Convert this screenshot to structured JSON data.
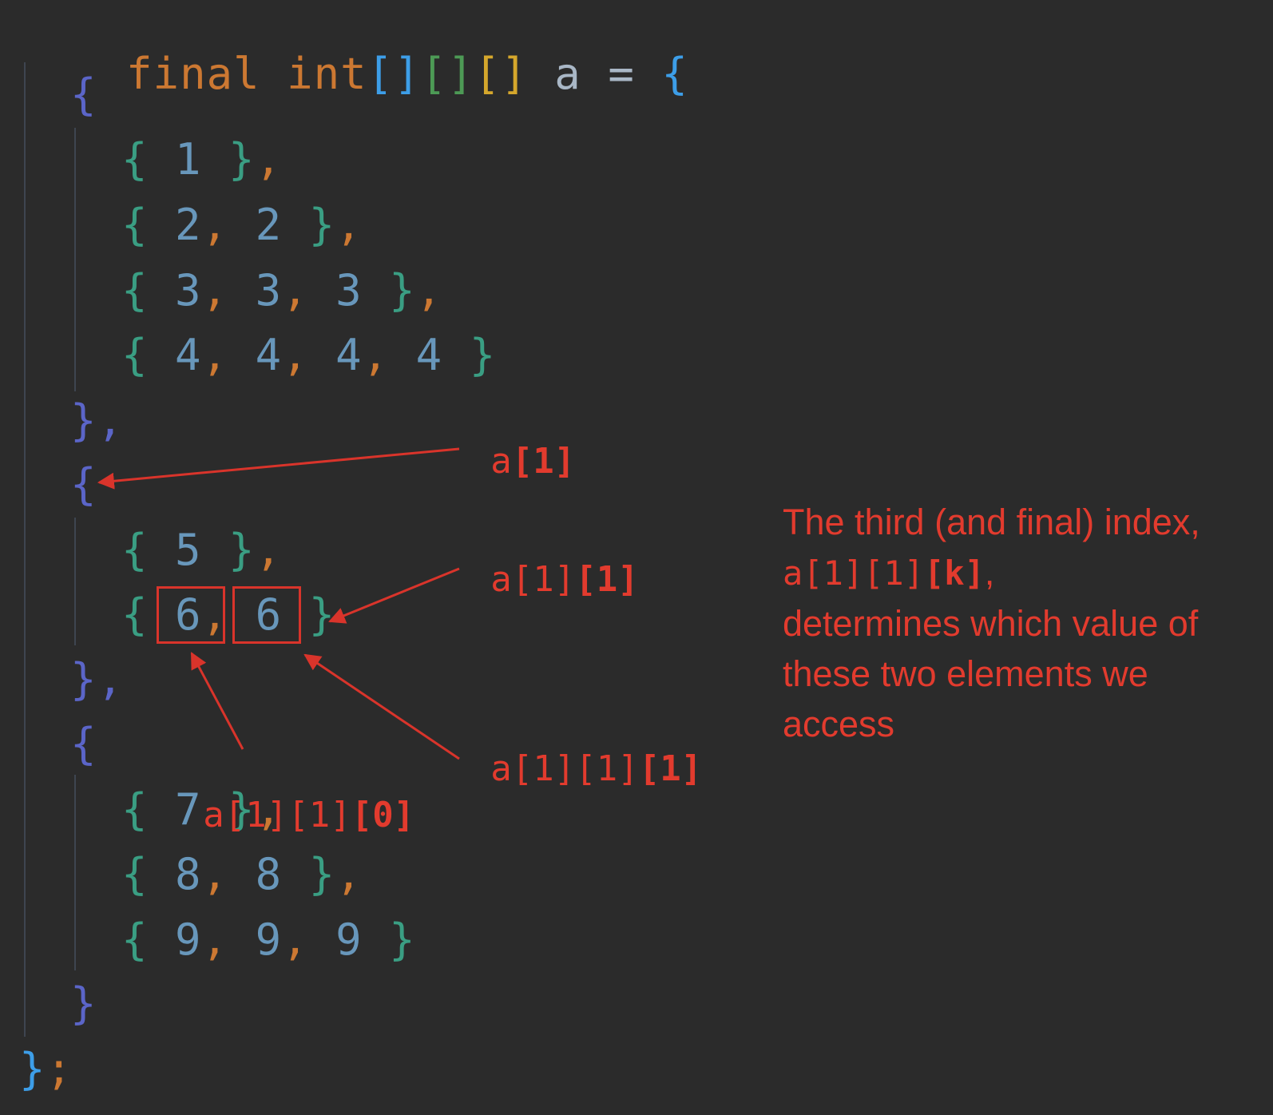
{
  "code": {
    "decl": {
      "keyword_final": "final",
      "keyword_type": "int",
      "var": "a",
      "equals": "=",
      "open": "{"
    },
    "blocks": [
      {
        "open": "{",
        "rows": [
          [
            "1"
          ],
          [
            "2",
            "2"
          ],
          [
            "3",
            "3",
            "3"
          ],
          [
            "4",
            "4",
            "4",
            "4"
          ]
        ],
        "close": "},"
      },
      {
        "open": "{",
        "rows": [
          [
            "5"
          ],
          [
            "6",
            "6"
          ]
        ],
        "close": "},"
      },
      {
        "open": "{",
        "rows": [
          [
            "7"
          ],
          [
            "8",
            "8"
          ],
          [
            "9",
            "9",
            "9"
          ]
        ],
        "close": "}"
      }
    ],
    "end": "};"
  },
  "annotations": {
    "a1": {
      "prefix": "a",
      "bold": "[1]"
    },
    "a11": {
      "prefix": "a[1]",
      "bold": "[1]"
    },
    "a111": {
      "prefix": "a[1][1]",
      "bold": "[1]"
    },
    "a110": {
      "prefix": "a[1][1]",
      "bold": "[0]"
    }
  },
  "note": {
    "line1": "The third (and final) index,",
    "code_prefix": "a[1][1]",
    "code_bold": "[k]",
    "code_suffix": ",",
    "line3": "determines which value of",
    "line4": "these two elements we",
    "line5": "access"
  },
  "colors": {
    "background": "#2b2b2b",
    "annotation": "#e23b2e"
  }
}
